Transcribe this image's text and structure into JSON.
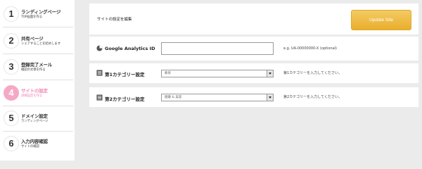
{
  "sidebar": {
    "steps": [
      {
        "number": "1",
        "title": "ランディングページ",
        "subtitle": "TOP画面を作る"
      },
      {
        "number": "2",
        "title": "共有ページ",
        "subtitle": "シェアすることを結めします"
      },
      {
        "number": "3",
        "title": "登録完了メール",
        "subtitle": "確認の文章を作る"
      },
      {
        "number": "4",
        "title": "サイトの設定",
        "subtitle": "詳細設定を作る",
        "active": true
      },
      {
        "number": "5",
        "title": "ドメイン設定",
        "subtitle": "ランディングページ"
      },
      {
        "number": "6",
        "title": "入力内容確認",
        "subtitle": "サイトの確認"
      }
    ]
  },
  "header": {
    "title": "サイトの設定を編集",
    "update_label": "Update Site"
  },
  "analytics": {
    "label": "Google Analytics ID",
    "value": "",
    "hint": "e.g. UA-00000000-X (optional)"
  },
  "category1": {
    "label": "第1カテゴリー設定",
    "selected": "教育",
    "hint": "第1カテゴリーを入力してください。"
  },
  "category2": {
    "label": "第2カテゴリー設定",
    "selected": "健康 & 美容",
    "hint": "第2カテゴリーを入力してください。"
  },
  "colors": {
    "accent_button": "#e9ae2d",
    "active_step": "#f08ab2"
  }
}
